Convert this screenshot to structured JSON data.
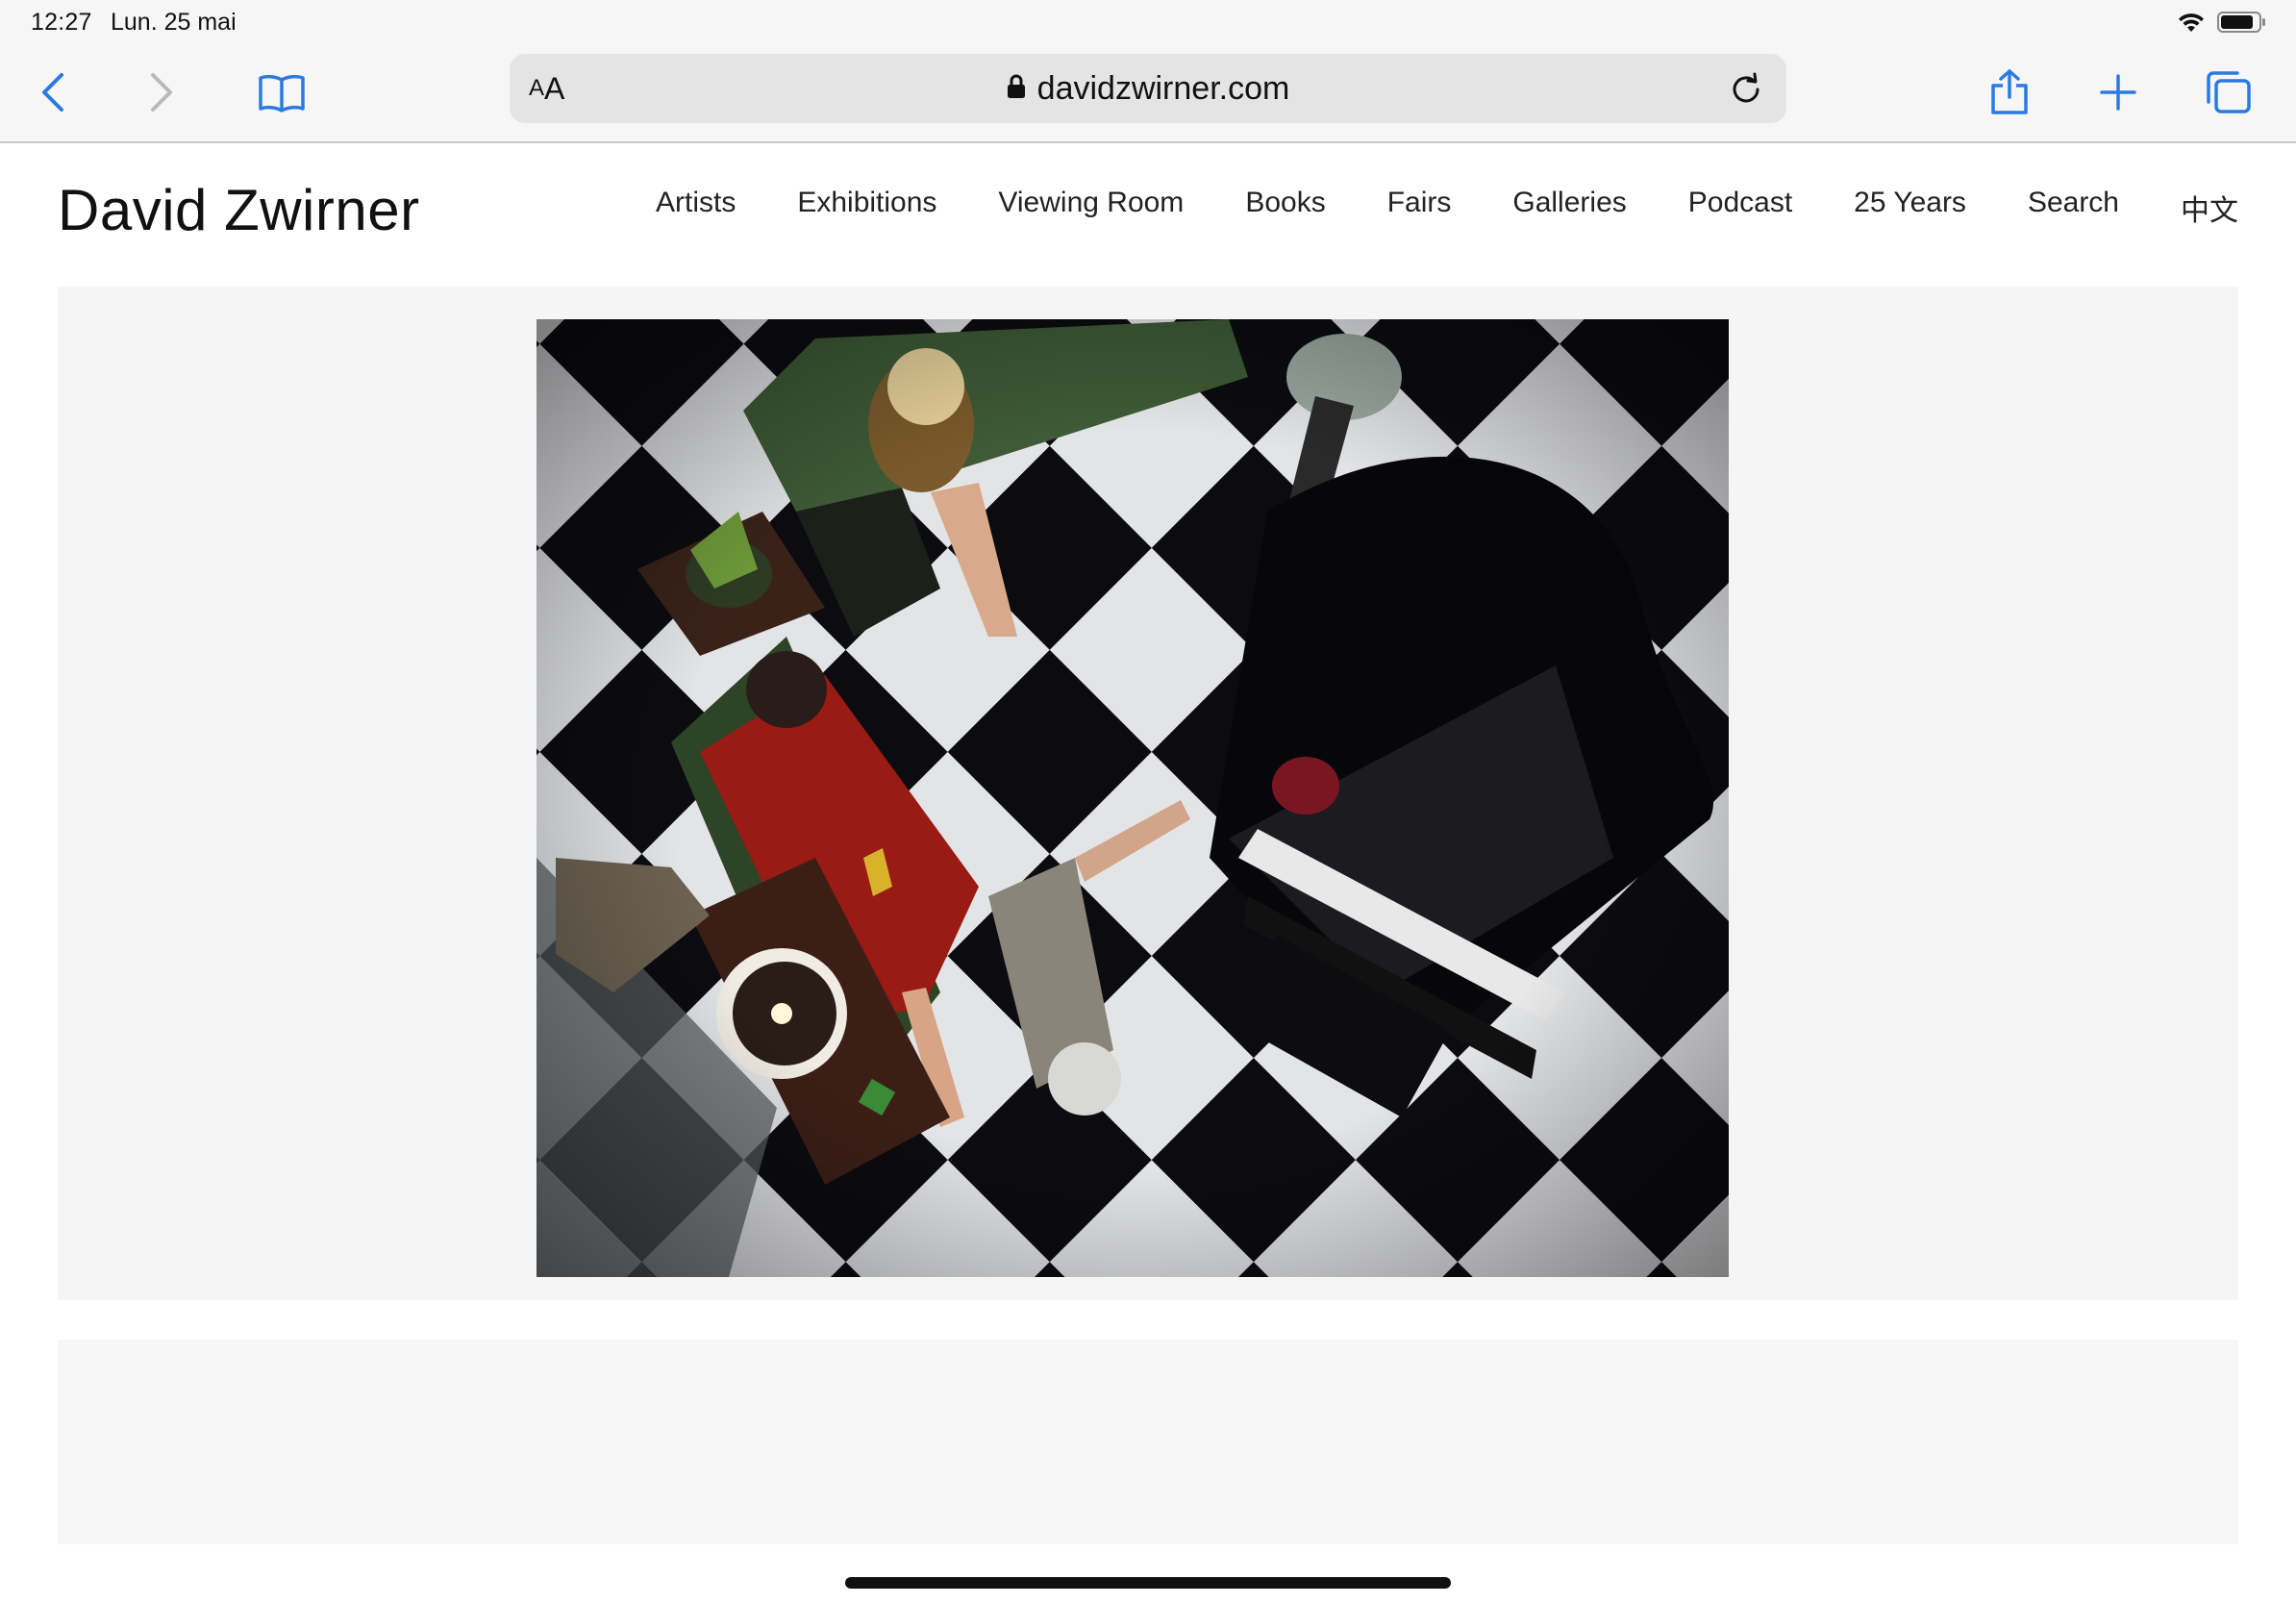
{
  "status_bar": {
    "time": "12:27",
    "date": "Lun. 25 mai"
  },
  "browser": {
    "aa_small": "A",
    "aa_big": "A",
    "url": "davidzwirner.com",
    "accent_color": "#2a7ae2"
  },
  "site": {
    "logo": "David Zwirner",
    "nav": [
      "Artists",
      "Exhibitions",
      "Viewing Room",
      "Books",
      "Fairs",
      "Galleries",
      "Podcast",
      "25 Years",
      "Search",
      "中文"
    ]
  }
}
